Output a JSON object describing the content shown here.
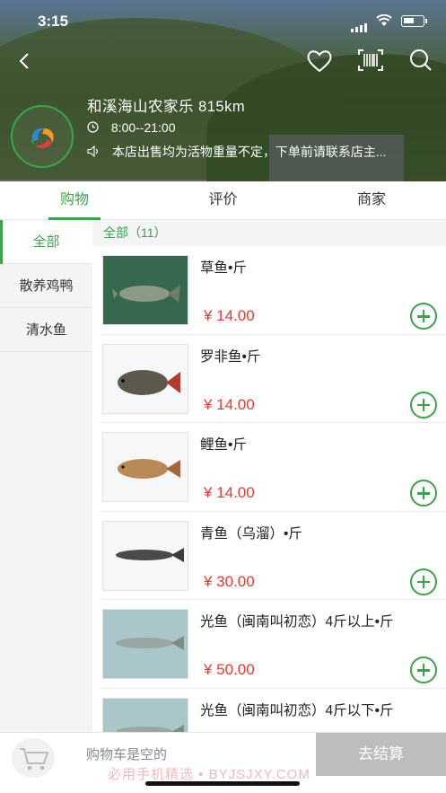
{
  "status": {
    "time": "3:15"
  },
  "shop": {
    "name": "和溪海山农家乐 815km",
    "hours": "8:00--21:00",
    "notice": "本店出售均为活物重量不定，下单前请联系店主..."
  },
  "tabs": [
    {
      "label": "购物",
      "active": true
    },
    {
      "label": "评价",
      "active": false
    },
    {
      "label": "商家",
      "active": false
    }
  ],
  "categories": [
    {
      "label": "全部",
      "active": true
    },
    {
      "label": "散养鸡鸭",
      "active": false
    },
    {
      "label": "清水鱼",
      "active": false
    }
  ],
  "list_header": "全部（11）",
  "items": [
    {
      "name": "草鱼•斤",
      "price": "¥ 14.00"
    },
    {
      "name": "罗非鱼•斤",
      "price": "¥ 14.00"
    },
    {
      "name": "鲤鱼•斤",
      "price": "¥ 14.00"
    },
    {
      "name": "青鱼（乌溜）•斤",
      "price": "¥ 30.00"
    },
    {
      "name": "光鱼（闽南叫初恋）4斤以上•斤",
      "price": "¥ 50.00"
    },
    {
      "name": "光鱼（闽南叫初恋）4斤以下•斤",
      "price": ""
    }
  ],
  "cart": {
    "empty_text": "购物车是空的",
    "checkout_label": "去结算"
  },
  "watermark": "必用手机精选 • BYJSJXY.COM",
  "colors": {
    "accent": "#3ca24a",
    "price": "#e03c2f",
    "checkout_disabled": "#bdbdbd"
  }
}
